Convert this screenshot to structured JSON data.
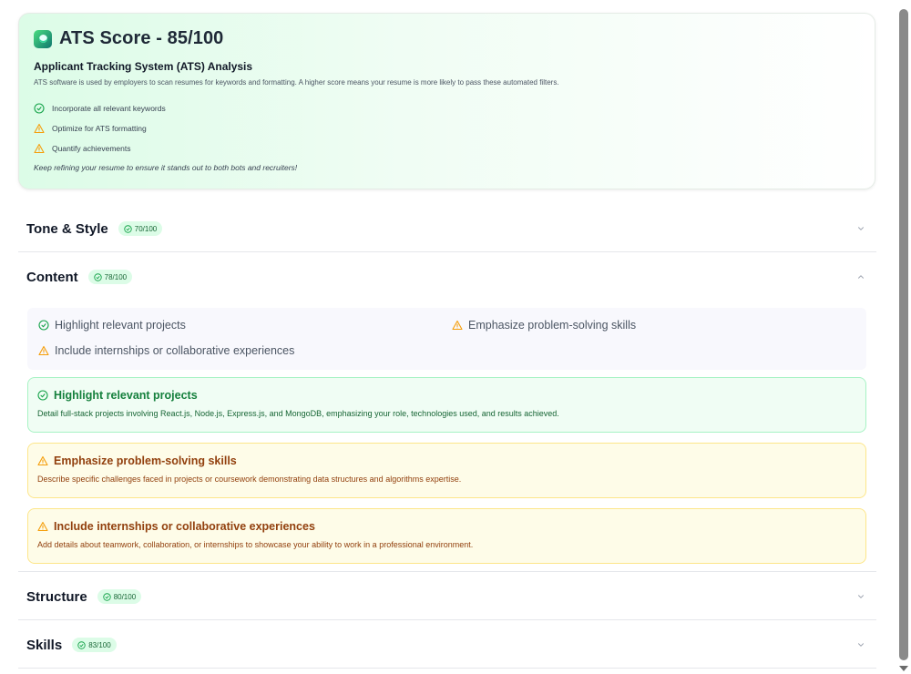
{
  "ats": {
    "title": "ATS Score - 85/100",
    "subtitle": "Applicant Tracking System (ATS) Analysis",
    "description": "ATS software is used by employers to scan resumes for keywords and formatting. A higher score means your resume is more likely to pass these automated filters.",
    "items": [
      {
        "icon": "check-circle-icon",
        "status": "good",
        "label": "Incorporate all relevant keywords"
      },
      {
        "icon": "warning-triangle-icon",
        "status": "warn",
        "label": "Optimize for ATS formatting"
      },
      {
        "icon": "warning-triangle-icon",
        "status": "warn",
        "label": "Quantify achievements"
      }
    ],
    "footer": "Keep refining your resume to ensure it stands out to both bots and recruiters!"
  },
  "sections": {
    "tone": {
      "title": "Tone & Style",
      "score": "70/100",
      "expanded": false
    },
    "content": {
      "title": "Content",
      "score": "78/100",
      "expanded": true,
      "summary": [
        {
          "status": "good",
          "label": "Highlight relevant projects"
        },
        {
          "status": "warn",
          "label": "Emphasize problem-solving skills"
        },
        {
          "status": "warn",
          "label": "Include internships or collaborative experiences"
        }
      ],
      "tips": [
        {
          "status": "good",
          "title": "Highlight relevant projects",
          "desc": "Detail full-stack projects involving React.js, Node.js, Express.js, and MongoDB, emphasizing your role, technologies used, and results achieved."
        },
        {
          "status": "warn",
          "title": "Emphasize problem-solving skills",
          "desc": "Describe specific challenges faced in projects or coursework demonstrating data structures and algorithms expertise."
        },
        {
          "status": "warn",
          "title": "Include internships or collaborative experiences",
          "desc": "Add details about teamwork, collaboration, or internships to showcase your ability to work in a professional environment."
        }
      ]
    },
    "structure": {
      "title": "Structure",
      "score": "80/100",
      "expanded": false
    },
    "skills": {
      "title": "Skills",
      "score": "83/100",
      "expanded": false
    }
  },
  "colors": {
    "good": "#16a34a",
    "warn": "#f59e0b",
    "badge_bg": "#dcfce7"
  }
}
